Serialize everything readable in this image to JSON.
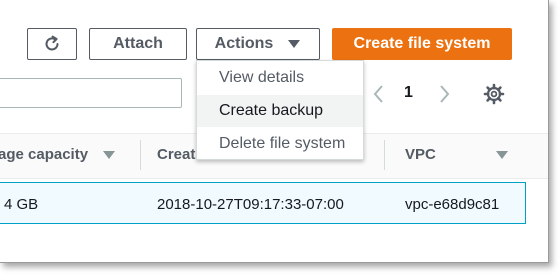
{
  "toolbar": {
    "refresh_icon": "refresh-icon",
    "attach_label": "Attach",
    "actions_label": "Actions",
    "create_label": "Create file system"
  },
  "actions_menu": {
    "items": [
      "View details",
      "Create backup",
      "Delete file system"
    ],
    "highlighted_index": 1
  },
  "search": {
    "placeholder": ""
  },
  "pagination": {
    "current_page": "1"
  },
  "table": {
    "columns": [
      "age capacity",
      "Creat",
      "VPC"
    ],
    "rows": [
      {
        "storage": "4 GB",
        "created": "2018-10-27T09:17:33-07:00",
        "vpc": "vpc-e68d9c81",
        "selected": true
      }
    ]
  },
  "colors": {
    "primary": "#ec7211",
    "selected_row_bg": "#f1faff",
    "selected_row_border": "#00a1c9",
    "text": "#545b64"
  }
}
